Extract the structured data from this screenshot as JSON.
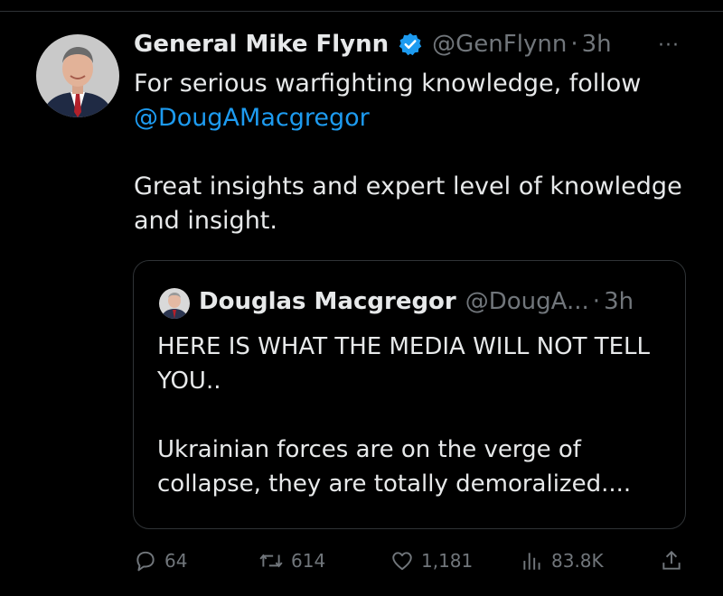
{
  "tweet": {
    "author_name": "General Mike Flynn",
    "handle": "@GenFlynn",
    "separator": "·",
    "time": "3h",
    "more_label": "···",
    "text_line1": "For serious warfighting knowledge, follow",
    "mention": "@DougAMacgregor",
    "text_para2": "Great insights and expert level of knowledge and insight."
  },
  "quote": {
    "author_name": "Douglas Macgregor",
    "handle": "@DougA...",
    "separator": "·",
    "time": "3h",
    "para1": "HERE IS WHAT THE MEDIA WILL NOT TELL YOU..",
    "para2": "Ukrainian forces are on the verge of collapse, they are totally demoralized...."
  },
  "actions": {
    "replies": "64",
    "reposts": "614",
    "likes": "1,181",
    "views": "83.8K"
  },
  "colors": {
    "background": "#000000",
    "text": "#e7e9ea",
    "muted": "#71767b",
    "link": "#1d9bf0",
    "verified": "#1d9bf0"
  }
}
